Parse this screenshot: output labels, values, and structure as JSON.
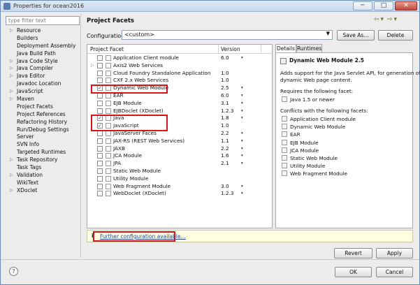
{
  "window": {
    "title": "Properties for ocean2016",
    "controls": [
      "─",
      "□",
      "✕"
    ]
  },
  "left_pane": {
    "filter_placeholder": "type filter text",
    "items": [
      {
        "label": "Resource",
        "expand": "▷"
      },
      {
        "label": "Builders",
        "expand": ""
      },
      {
        "label": "Deployment Assembly",
        "expand": ""
      },
      {
        "label": "Java Build Path",
        "expand": ""
      },
      {
        "label": "Java Code Style",
        "expand": "▷"
      },
      {
        "label": "Java Compiler",
        "expand": "▷"
      },
      {
        "label": "Java Editor",
        "expand": "▷"
      },
      {
        "label": "Javadoc Location",
        "expand": ""
      },
      {
        "label": "JavaScript",
        "expand": "▷"
      },
      {
        "label": "Maven",
        "expand": "▷"
      },
      {
        "label": "Project Facets",
        "expand": ""
      },
      {
        "label": "Project References",
        "expand": ""
      },
      {
        "label": "Refactoring History",
        "expand": ""
      },
      {
        "label": "Run/Debug Settings",
        "expand": ""
      },
      {
        "label": "Server",
        "expand": ""
      },
      {
        "label": "SVN Info",
        "expand": ""
      },
      {
        "label": "Targeted Runtimes",
        "expand": ""
      },
      {
        "label": "Task Repository",
        "expand": "▷"
      },
      {
        "label": "Task Tags",
        "expand": ""
      },
      {
        "label": "Validation",
        "expand": "▷"
      },
      {
        "label": "WikiText",
        "expand": ""
      },
      {
        "label": "XDoclet",
        "expand": "▷"
      }
    ]
  },
  "header": {
    "title": "Project Facets",
    "nav_arrows": [
      "⇦",
      "▾",
      "⇨",
      "▾"
    ]
  },
  "configuration": {
    "label": "Configuration:",
    "value": "<custom>",
    "save_as": "Save As...",
    "delete": "Delete"
  },
  "facets": {
    "col_facet": "Project Facet",
    "col_version": "Version",
    "rows": [
      {
        "name": "Application Client module",
        "version": "6.0",
        "checked": false,
        "expand": "",
        "dd": "▾"
      },
      {
        "name": "Axis2 Web Services",
        "version": "",
        "checked": false,
        "expand": "▷",
        "dd": ""
      },
      {
        "name": "Cloud Foundry Standalone Application",
        "version": "1.0",
        "checked": false,
        "expand": "",
        "dd": ""
      },
      {
        "name": "CXF 2.x Web Services",
        "version": "1.0",
        "checked": false,
        "expand": "",
        "dd": ""
      },
      {
        "name": "Dynamic Web Module",
        "version": "2.5",
        "checked": true,
        "expand": "",
        "dd": "▾"
      },
      {
        "name": "EAR",
        "version": "6.0",
        "checked": false,
        "expand": "",
        "dd": "▾"
      },
      {
        "name": "EJB Module",
        "version": "3.1",
        "checked": false,
        "expand": "",
        "dd": "▾"
      },
      {
        "name": "EJBDoclet (XDoclet)",
        "version": "1.2.3",
        "checked": false,
        "expand": "",
        "dd": "▾"
      },
      {
        "name": "Java",
        "version": "1.8",
        "checked": true,
        "expand": "",
        "dd": "▾"
      },
      {
        "name": "JavaScript",
        "version": "1.0",
        "checked": true,
        "expand": "",
        "dd": ""
      },
      {
        "name": "JavaServer Faces",
        "version": "2.2",
        "checked": false,
        "expand": "",
        "dd": "▾"
      },
      {
        "name": "JAX-RS (REST Web Services)",
        "version": "1.1",
        "checked": false,
        "expand": "",
        "dd": "▾"
      },
      {
        "name": "JAXB",
        "version": "2.2",
        "checked": false,
        "expand": "",
        "dd": "▾"
      },
      {
        "name": "JCA Module",
        "version": "1.6",
        "checked": false,
        "expand": "",
        "dd": "▾"
      },
      {
        "name": "JPA",
        "version": "2.1",
        "checked": false,
        "expand": "",
        "dd": "▾"
      },
      {
        "name": "Static Web Module",
        "version": "",
        "checked": false,
        "expand": "",
        "dd": ""
      },
      {
        "name": "Utility Module",
        "version": "",
        "checked": false,
        "expand": "",
        "dd": ""
      },
      {
        "name": "Web Fragment Module",
        "version": "3.0",
        "checked": false,
        "expand": "",
        "dd": "▾"
      },
      {
        "name": "WebDoclet (XDoclet)",
        "version": "1.2.3",
        "checked": false,
        "expand": "",
        "dd": "▾"
      }
    ]
  },
  "details": {
    "tab_details": "Details",
    "tab_runtimes": "Runtimes",
    "title": "Dynamic Web Module 2.5",
    "desc_line1": "Adds support for the Java Servlet API, for generation of",
    "desc_line2": "dynamic Web page content.",
    "requires_label": "Requires the following facet:",
    "requires": [
      "Java 1.5 or newer"
    ],
    "conflicts_label": "Conflicts with the following facets:",
    "conflicts": [
      "Application Client module",
      "Dynamic Web Module",
      "EAR",
      "EJB Module",
      "JCA Module",
      "Static Web Module",
      "Utility Module",
      "Web Fragment Module"
    ]
  },
  "info_bar": {
    "icon": "i",
    "link": "Further configuration available..."
  },
  "buttons": {
    "revert": "Revert",
    "apply": "Apply",
    "ok": "OK",
    "cancel": "Cancel",
    "help": "?"
  },
  "colors": {
    "highlight": "#d4141d",
    "link": "#1f47a8"
  }
}
